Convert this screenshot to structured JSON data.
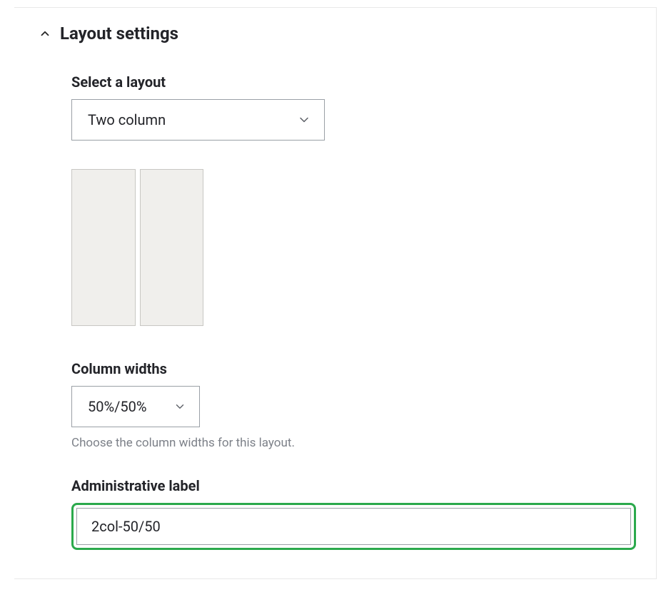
{
  "section": {
    "title": "Layout settings"
  },
  "fields": {
    "layout": {
      "label": "Select a layout",
      "value": "Two column"
    },
    "widths": {
      "label": "Column widths",
      "value": "50%/50%",
      "help": "Choose the column widths for this layout."
    },
    "adminLabel": {
      "label": "Administrative label",
      "value": "2col-50/50"
    }
  }
}
